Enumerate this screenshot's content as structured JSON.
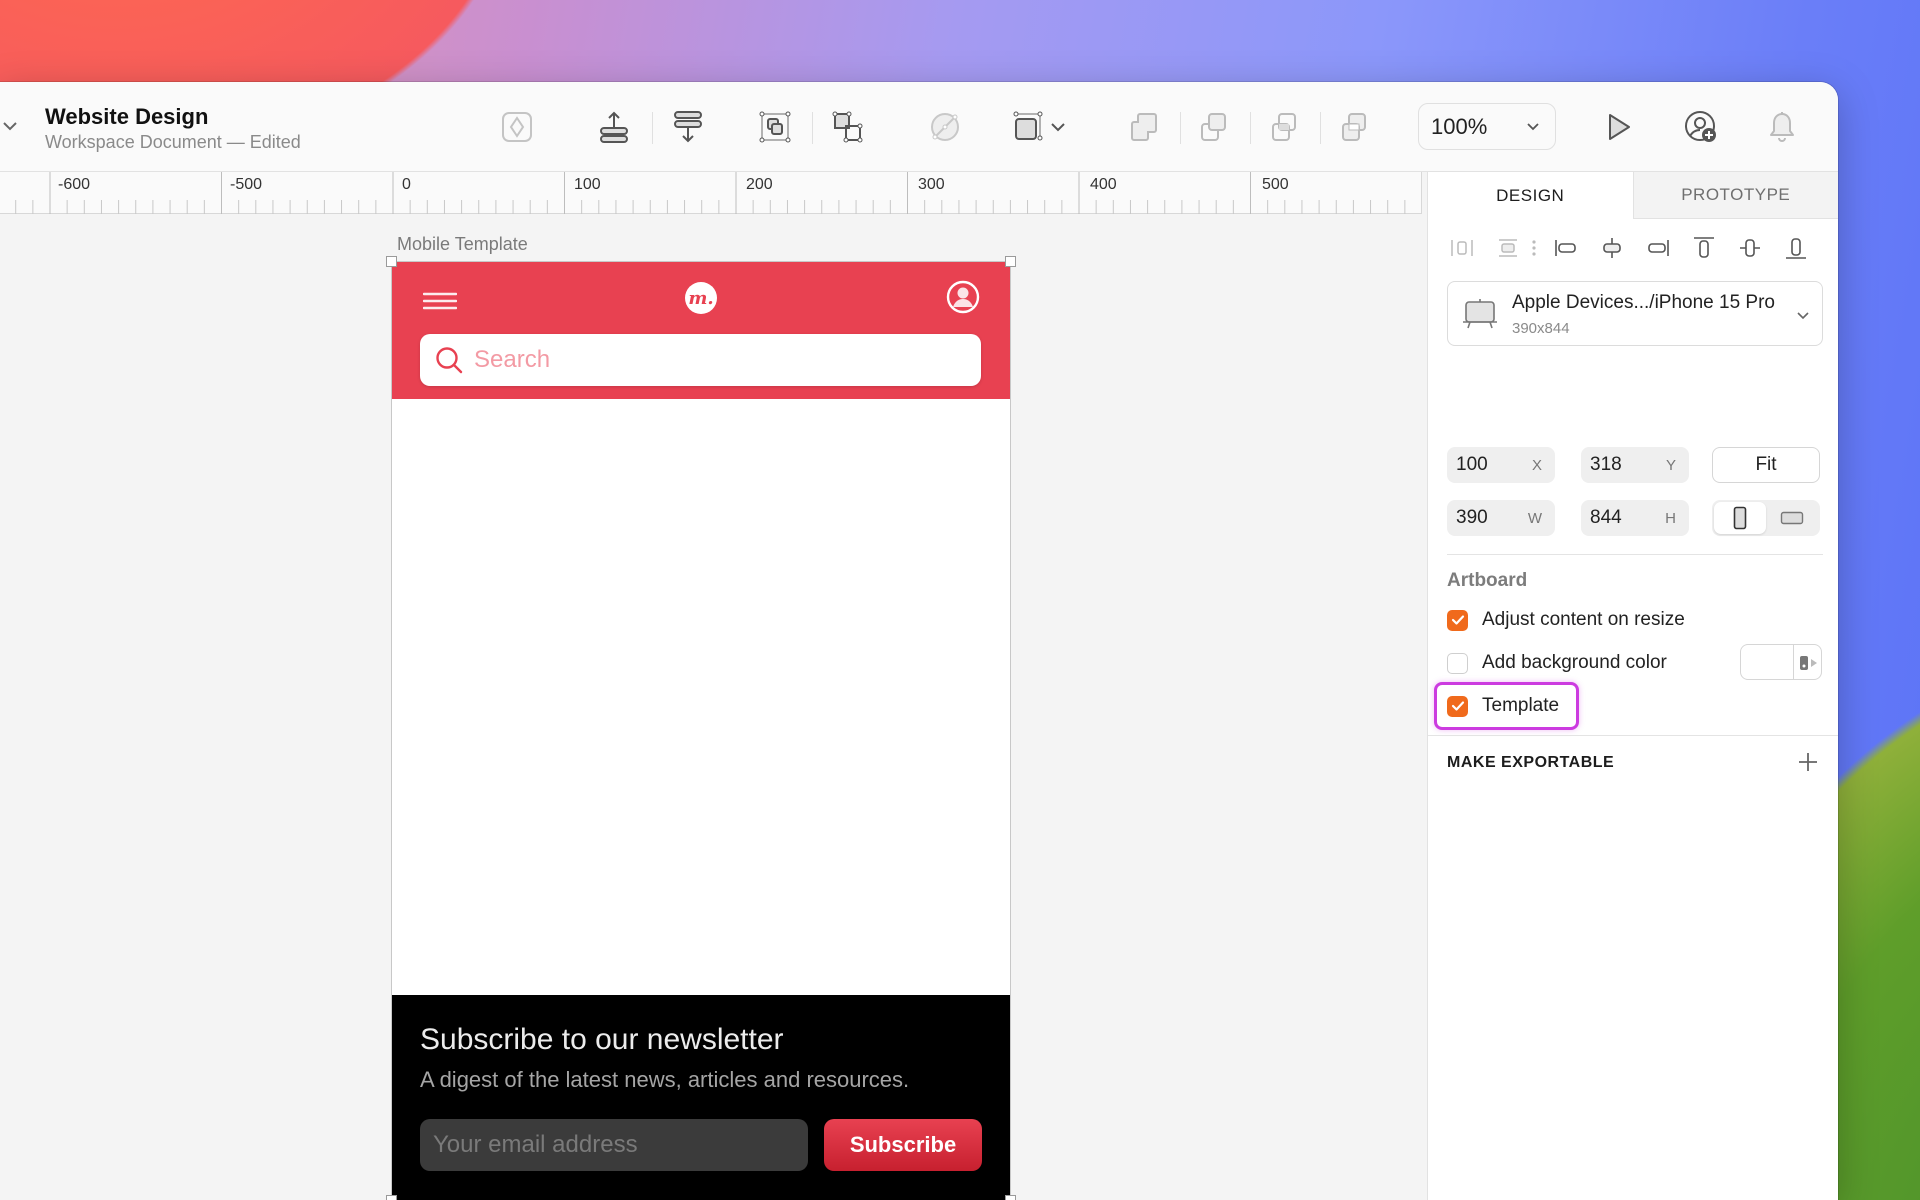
{
  "document": {
    "title": "Website Design",
    "subtitle": "Workspace Document — Edited"
  },
  "toolbar": {
    "icons": [
      "symbol-icon",
      "move-forward-icon",
      "move-backward-icon",
      "group-icon",
      "ungroup-icon",
      "mask-icon",
      "resize-icon",
      "union-icon",
      "subtract-icon",
      "intersect-icon",
      "difference-icon",
      "play-icon",
      "add-collaborator-icon",
      "notifications-icon"
    ],
    "zoom": "100%"
  },
  "ruler": {
    "labels": [
      "-600",
      "-500",
      "0",
      "100",
      "200",
      "300",
      "400",
      "500"
    ]
  },
  "artboard": {
    "label": "Mobile Template",
    "header": {
      "logo_letter": "m.",
      "search_placeholder": "Search",
      "brand_color": "#e84151"
    },
    "footer": {
      "title": "Subscribe to our newsletter",
      "subtitle": "A digest of the latest news, articles and resources.",
      "email_placeholder": "Your email address",
      "button_label": "Subscribe"
    }
  },
  "inspector": {
    "tabs": [
      {
        "label": "DESIGN",
        "active": true
      },
      {
        "label": "PROTOTYPE",
        "active": false
      }
    ],
    "device": {
      "name": "Apple Devices.../iPhone 15 Pro",
      "size": "390x844"
    },
    "position": {
      "x": "100",
      "x_label": "X",
      "y": "318",
      "y_label": "Y",
      "w": "390",
      "w_label": "W",
      "h": "844",
      "h_label": "H"
    },
    "fit_label": "Fit",
    "orientation": "portrait",
    "artboard_section": {
      "title": "Artboard",
      "options": [
        {
          "label": "Adjust content on resize",
          "checked": true
        },
        {
          "label": "Add background color",
          "checked": false
        },
        {
          "label": "Template",
          "checked": true
        }
      ]
    },
    "export_title": "MAKE EXPORTABLE",
    "accent_color": "#f06a1c",
    "highlight_color": "#cc3be0"
  }
}
